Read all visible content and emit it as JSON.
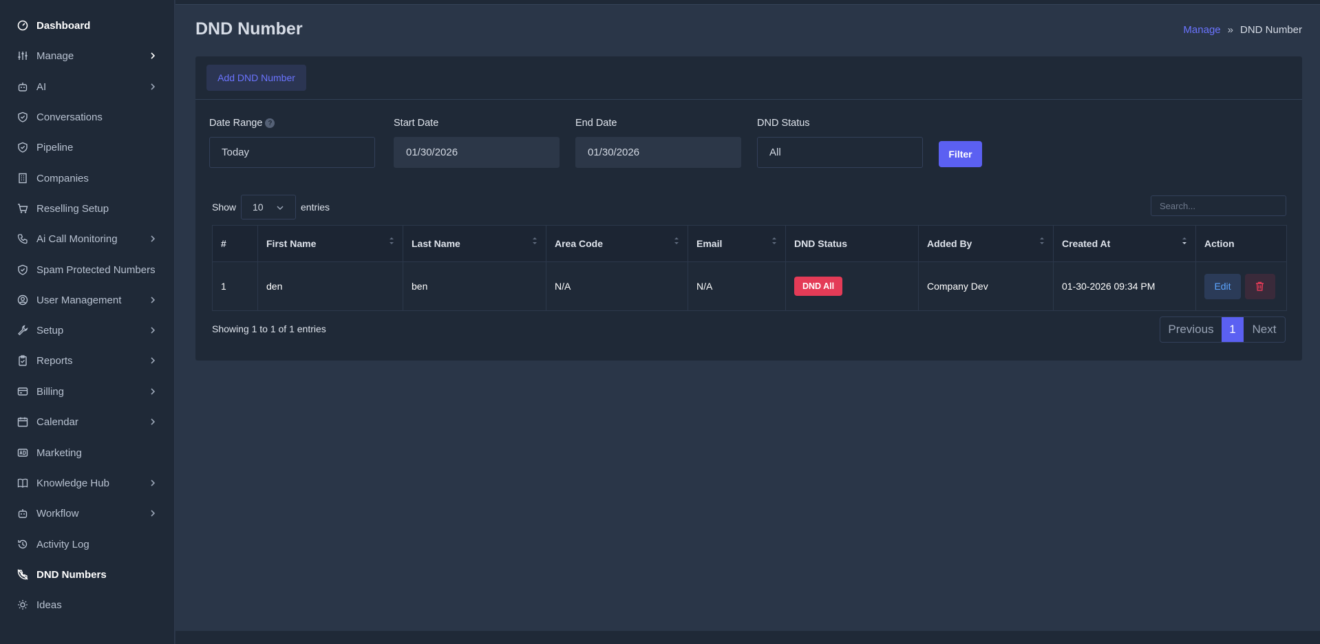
{
  "sidebar": {
    "items": [
      {
        "label": "Dashboard",
        "icon": "dashboard-icon",
        "chevron": false,
        "active": true
      },
      {
        "label": "Manage",
        "icon": "sliders-icon",
        "chevron": true,
        "active": false
      },
      {
        "label": "AI",
        "icon": "robot-icon",
        "chevron": true,
        "active": false
      },
      {
        "label": "Conversations",
        "icon": "shield-icon",
        "chevron": false,
        "active": false
      },
      {
        "label": "Pipeline",
        "icon": "shield-icon",
        "chevron": false,
        "active": false
      },
      {
        "label": "Companies",
        "icon": "building-icon",
        "chevron": false,
        "active": false
      },
      {
        "label": "Reselling Setup",
        "icon": "cart-icon",
        "chevron": false,
        "active": false
      },
      {
        "label": "Ai Call Monitoring",
        "icon": "phone-icon",
        "chevron": true,
        "active": false
      },
      {
        "label": "Spam Protected Numbers",
        "icon": "shield-icon",
        "chevron": false,
        "active": false
      },
      {
        "label": "User Management",
        "icon": "user-circle-icon",
        "chevron": true,
        "active": false
      },
      {
        "label": "Setup",
        "icon": "wrench-icon",
        "chevron": true,
        "active": false
      },
      {
        "label": "Reports",
        "icon": "clipboard-icon",
        "chevron": true,
        "active": false
      },
      {
        "label": "Billing",
        "icon": "credit-card-icon",
        "chevron": true,
        "active": false
      },
      {
        "label": "Calendar",
        "icon": "calendar-icon",
        "chevron": true,
        "active": false
      },
      {
        "label": "Marketing",
        "icon": "ad-icon",
        "chevron": false,
        "active": false
      },
      {
        "label": "Knowledge Hub",
        "icon": "book-icon",
        "chevron": true,
        "active": false
      },
      {
        "label": "Workflow",
        "icon": "robot-icon",
        "chevron": true,
        "active": false
      },
      {
        "label": "Activity Log",
        "icon": "history-icon",
        "chevron": false,
        "active": false
      },
      {
        "label": "DND Numbers",
        "icon": "phone-off-icon",
        "chevron": false,
        "active": true
      },
      {
        "label": "Ideas",
        "icon": "bulb-icon",
        "chevron": false,
        "active": false
      }
    ]
  },
  "header": {
    "title": "DND Number",
    "breadcrumb": {
      "parent": "Manage",
      "separator": "»",
      "current": "DND Number"
    }
  },
  "card": {
    "add_button": "Add DND Number",
    "filters": {
      "date_range": {
        "label": "Date Range",
        "value": "Today"
      },
      "start_date": {
        "label": "Start Date",
        "value": "01/30/2026"
      },
      "end_date": {
        "label": "End Date",
        "value": "01/30/2026"
      },
      "dnd_status": {
        "label": "DND Status",
        "value": "All"
      },
      "filter_button": "Filter"
    },
    "length": {
      "show": "Show",
      "value": "10",
      "entries": "entries"
    },
    "search": {
      "placeholder": "Search..."
    }
  },
  "table": {
    "columns": [
      "#",
      "First Name",
      "Last Name",
      "Area Code",
      "Email",
      "DND Status",
      "Added By",
      "Created At",
      "Action"
    ],
    "rows": [
      {
        "num": "1",
        "first": "den",
        "last": "ben",
        "area": "N/A",
        "email": "N/A",
        "status": "DND All",
        "added_by": "Company Dev",
        "created": "01-30-2026 09:34 PM",
        "edit": "Edit"
      }
    ]
  },
  "footer": {
    "showing": "Showing 1 to 1 of 1 entries",
    "previous": "Previous",
    "page": "1",
    "next": "Next"
  },
  "colors": {
    "accent": "#5b60f2",
    "danger": "#e43b57",
    "sidebar_bg": "#1f2937",
    "page_bg": "#2a3648"
  }
}
